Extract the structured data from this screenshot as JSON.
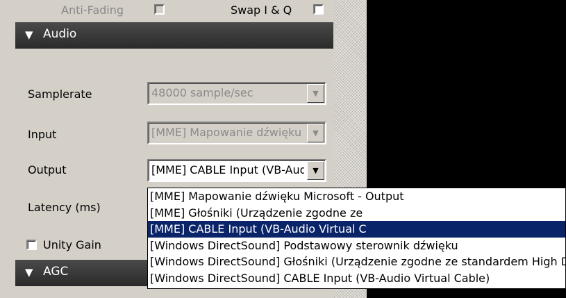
{
  "top_row": {
    "anti_fading_label": "Anti-Fading",
    "swap_label": "Swap I & Q"
  },
  "audio_section": {
    "title": "Audio",
    "samplerate_label": "Samplerate",
    "samplerate_value": "48000 sample/sec",
    "input_label": "Input",
    "input_value": "[MME] Mapowanie dźwięku Microsoft - Input",
    "output_label": "Output",
    "output_value": "[MME] CABLE Input (VB-Audio Virtual C",
    "latency_label": "Latency (ms)",
    "unity_gain_label": "Unity Gain"
  },
  "agc_section": {
    "title": "AGC"
  },
  "output_dropdown": {
    "options": [
      "[MME] Mapowanie dźwięku Microsoft - Output",
      "[MME] Głośniki (Urządzenie zgodne ze",
      "[MME] CABLE Input (VB-Audio Virtual C",
      "[Windows DirectSound] Podstawowy sterownik dźwięku",
      "[Windows DirectSound] Głośniki (Urządzenie zgodne ze standardem High Definition Audio)",
      "[Windows DirectSound] CABLE Input (VB-Audio Virtual Cable)"
    ],
    "selected_index": 2
  },
  "colors": {
    "panel_bg": "#d4d0c8",
    "header_bg": "#333333",
    "selection_bg": "#0a246a",
    "display_bg": "#000000"
  }
}
